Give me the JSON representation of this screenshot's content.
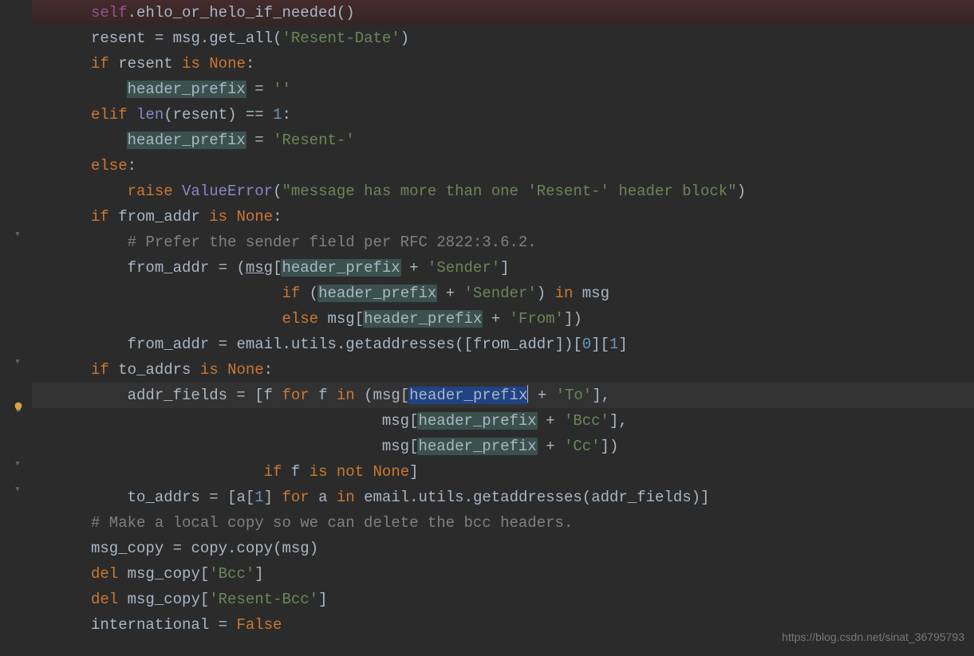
{
  "watermark": "https://blog.csdn.net/sinat_36795793",
  "strings": {
    "resent_date": "'Resent-Date'",
    "empty": "''",
    "resent_dash": "'Resent-'",
    "value_err_msg": "\"message has more than one 'Resent-' header block\"",
    "sender": "'Sender'",
    "from": "'From'",
    "to": "'To'",
    "bcc": "'Bcc'",
    "cc": "'Cc'",
    "resent_bcc": "'Resent-Bcc'"
  },
  "nums": {
    "one": "1",
    "zero": "0",
    "one_idx": "1"
  },
  "idents": {
    "self": "self",
    "ehlo": "ehlo_or_helo_if_needed",
    "resent": "resent",
    "msg": "msg",
    "get_all": "get_all",
    "header_prefix": "header_prefix",
    "len": "len",
    "ValueError": "ValueError",
    "from_addr": "from_addr",
    "email": "email",
    "utils": "utils",
    "getaddresses": "getaddresses",
    "to_addrs": "to_addrs",
    "addr_fields": "addr_fields",
    "f": "f",
    "a": "a",
    "msg_copy": "msg_copy",
    "copy": "copy",
    "international": "international"
  },
  "kw": {
    "if": "if",
    "is": "is",
    "None": "None",
    "elif": "elif",
    "else": "else",
    "raise": "raise",
    "for": "for",
    "in": "in",
    "not": "not",
    "del": "del",
    "False": "False"
  },
  "comments": {
    "prefer_sender": "# Prefer the sender field per RFC 2822:3.6.2.",
    "local_copy": "# Make a local copy so we can delete the bcc headers."
  }
}
